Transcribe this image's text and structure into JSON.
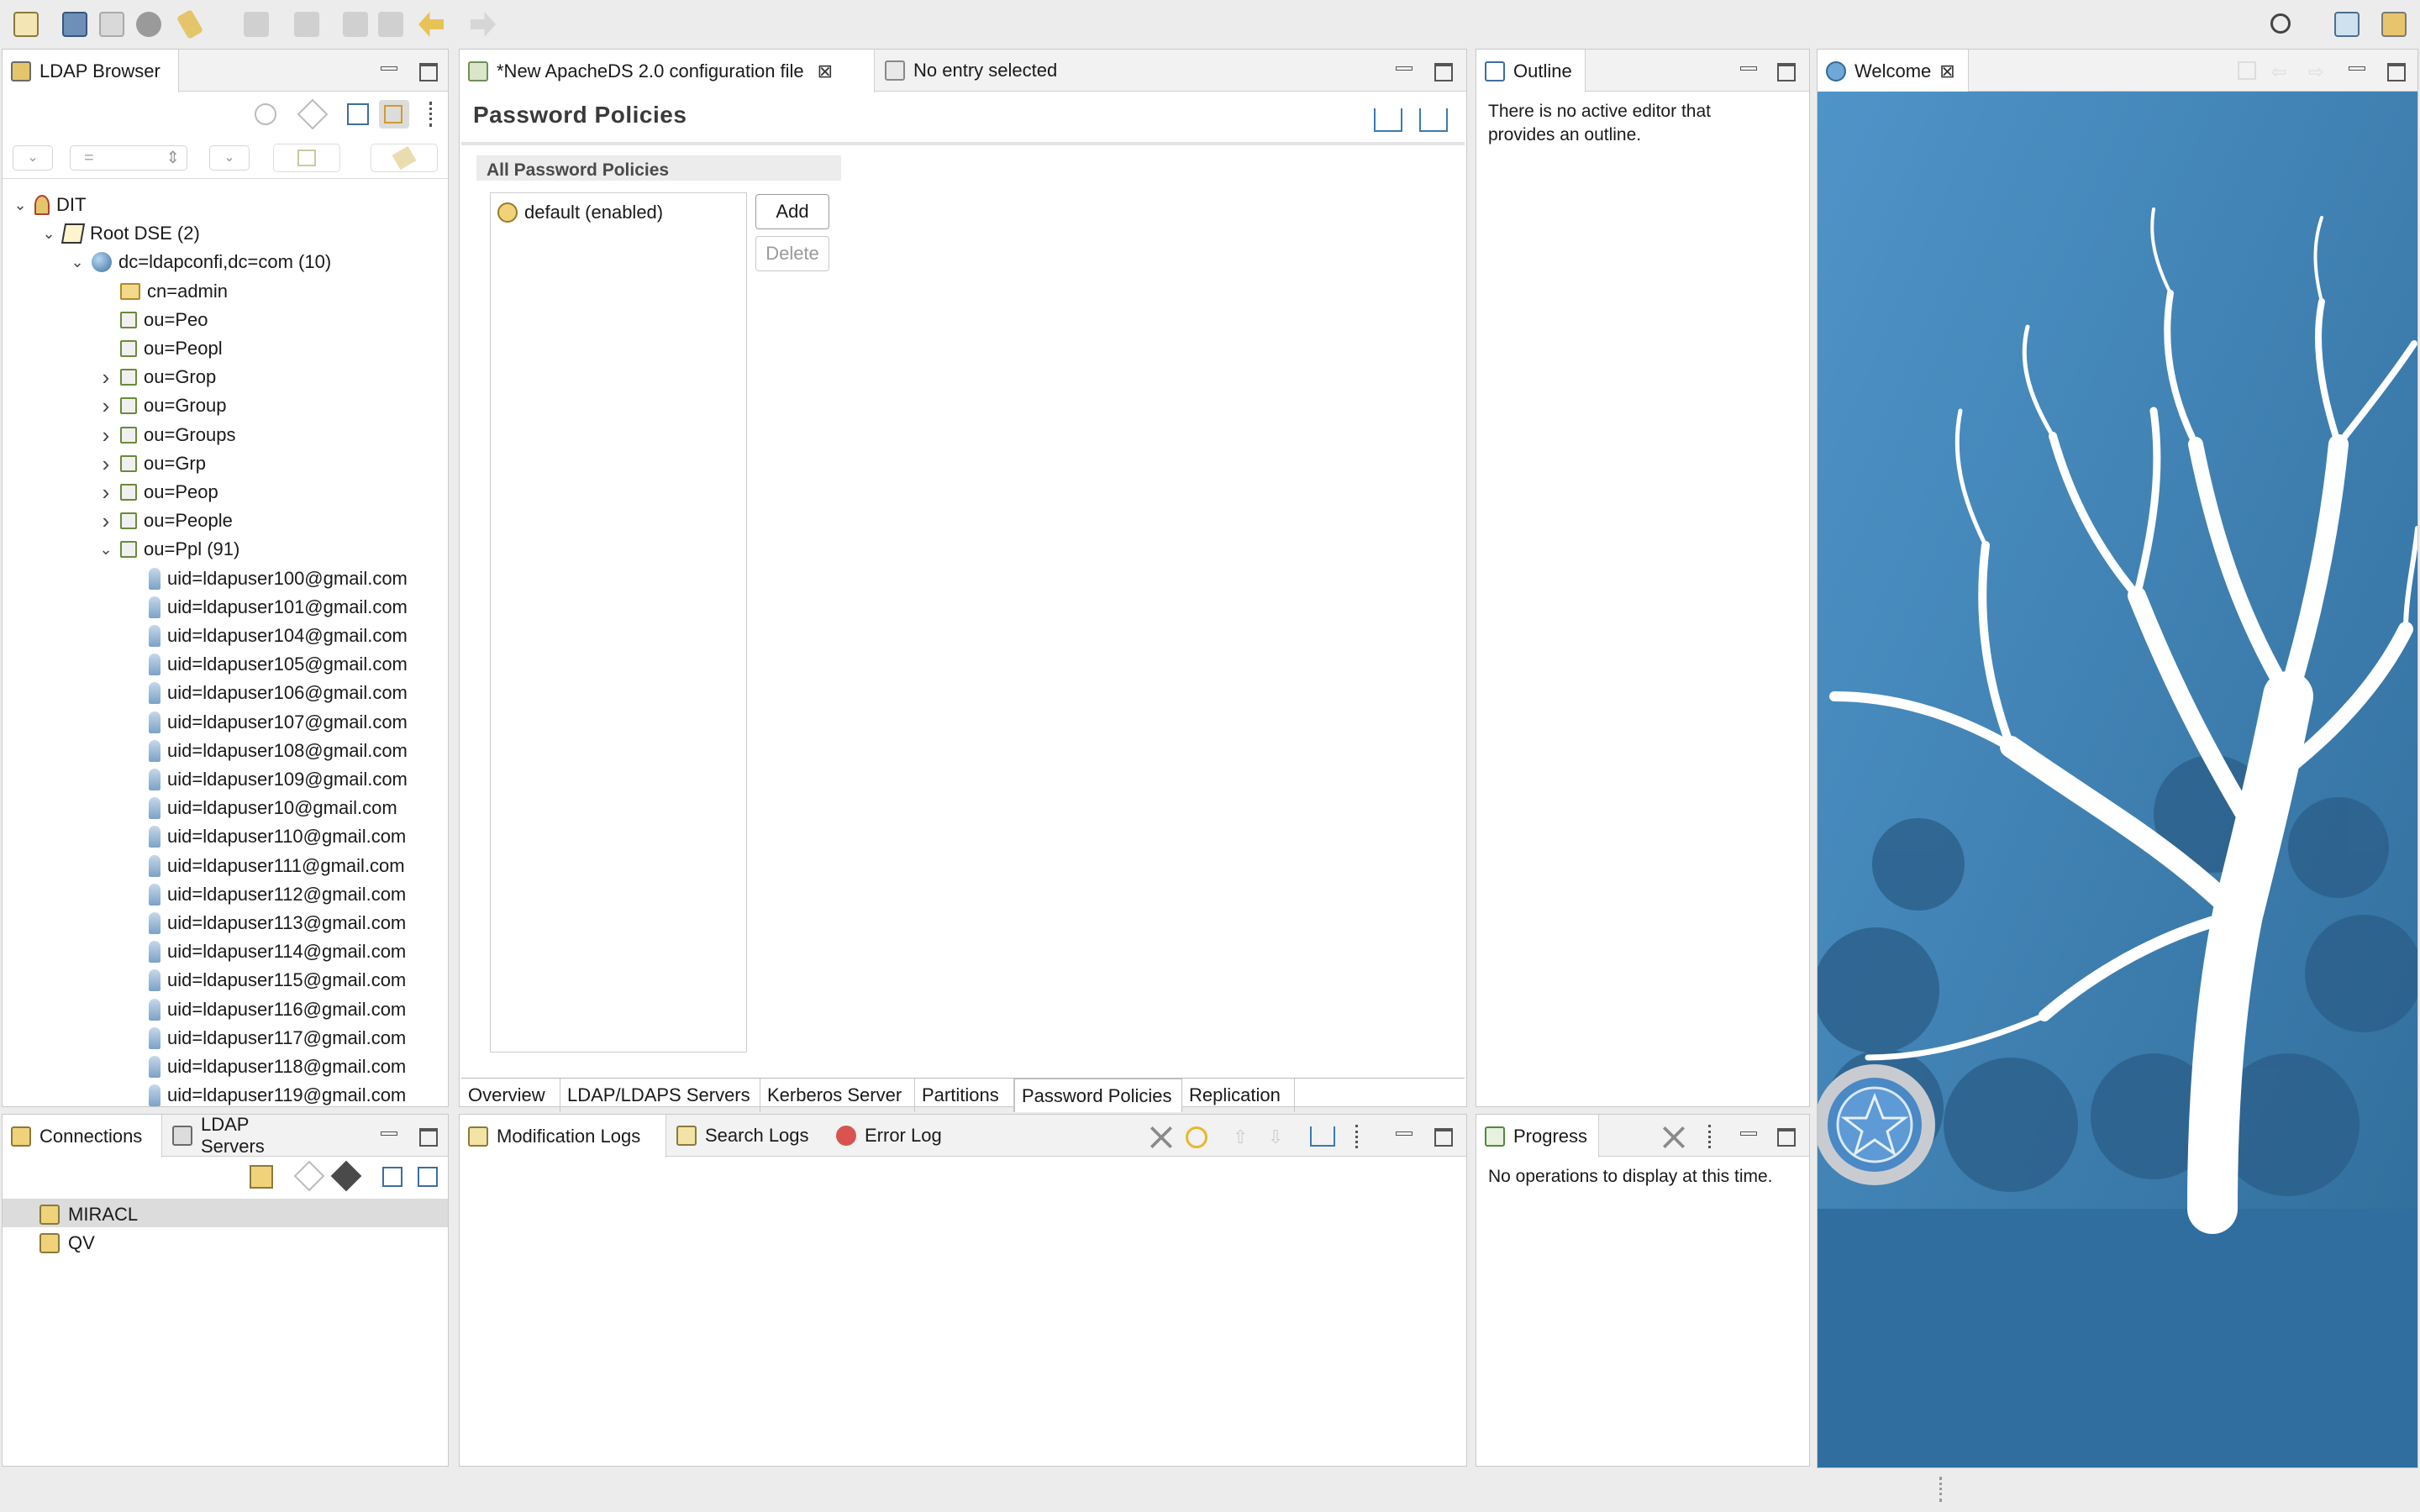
{
  "browser": {
    "tab_label": "LDAP Browser",
    "filter_value": "=",
    "tree": [
      {
        "label": "DIT",
        "level": 0,
        "expanded": true,
        "icon": "dit-icon"
      },
      {
        "label": "Root DSE (2)",
        "level": 1,
        "expanded": true,
        "icon": "rootdse-icon"
      },
      {
        "label": "dc=ldapconfi,dc=com (10)",
        "level": 2,
        "expanded": true,
        "icon": "globe-icon"
      },
      {
        "label": "cn=admin",
        "level": 3,
        "expanded": null,
        "icon": "folder-icon"
      },
      {
        "label": "ou=Peo",
        "level": 3,
        "expanded": null,
        "icon": "ou-icon"
      },
      {
        "label": "ou=Peopl",
        "level": 3,
        "expanded": null,
        "icon": "ou-icon"
      },
      {
        "label": "ou=Grop",
        "level": 3,
        "expanded": false,
        "icon": "ou-icon"
      },
      {
        "label": "ou=Group",
        "level": 3,
        "expanded": false,
        "icon": "ou-icon"
      },
      {
        "label": "ou=Groups",
        "level": 3,
        "expanded": false,
        "icon": "ou-icon"
      },
      {
        "label": "ou=Grp",
        "level": 3,
        "expanded": false,
        "icon": "ou-icon"
      },
      {
        "label": "ou=Peop",
        "level": 3,
        "expanded": false,
        "icon": "ou-icon"
      },
      {
        "label": "ou=People",
        "level": 3,
        "expanded": false,
        "icon": "ou-icon"
      },
      {
        "label": "ou=Ppl (91)",
        "level": 3,
        "expanded": true,
        "icon": "ou-icon"
      },
      {
        "label": "uid=ldapuser100@gmail.com",
        "level": 4,
        "expanded": null,
        "icon": "person-icon"
      },
      {
        "label": "uid=ldapuser101@gmail.com",
        "level": 4,
        "expanded": null,
        "icon": "person-icon"
      },
      {
        "label": "uid=ldapuser104@gmail.com",
        "level": 4,
        "expanded": null,
        "icon": "person-icon"
      },
      {
        "label": "uid=ldapuser105@gmail.com",
        "level": 4,
        "expanded": null,
        "icon": "person-icon"
      },
      {
        "label": "uid=ldapuser106@gmail.com",
        "level": 4,
        "expanded": null,
        "icon": "person-icon"
      },
      {
        "label": "uid=ldapuser107@gmail.com",
        "level": 4,
        "expanded": null,
        "icon": "person-icon"
      },
      {
        "label": "uid=ldapuser108@gmail.com",
        "level": 4,
        "expanded": null,
        "icon": "person-icon"
      },
      {
        "label": "uid=ldapuser109@gmail.com",
        "level": 4,
        "expanded": null,
        "icon": "person-icon"
      },
      {
        "label": "uid=ldapuser10@gmail.com",
        "level": 4,
        "expanded": null,
        "icon": "person-icon"
      },
      {
        "label": "uid=ldapuser110@gmail.com",
        "level": 4,
        "expanded": null,
        "icon": "person-icon"
      },
      {
        "label": "uid=ldapuser111@gmail.com",
        "level": 4,
        "expanded": null,
        "icon": "person-icon"
      },
      {
        "label": "uid=ldapuser112@gmail.com",
        "level": 4,
        "expanded": null,
        "icon": "person-icon"
      },
      {
        "label": "uid=ldapuser113@gmail.com",
        "level": 4,
        "expanded": null,
        "icon": "person-icon"
      },
      {
        "label": "uid=ldapuser114@gmail.com",
        "level": 4,
        "expanded": null,
        "icon": "person-icon"
      },
      {
        "label": "uid=ldapuser115@gmail.com",
        "level": 4,
        "expanded": null,
        "icon": "person-icon"
      },
      {
        "label": "uid=ldapuser116@gmail.com",
        "level": 4,
        "expanded": null,
        "icon": "person-icon"
      },
      {
        "label": "uid=ldapuser117@gmail.com",
        "level": 4,
        "expanded": null,
        "icon": "person-icon"
      },
      {
        "label": "uid=ldapuser118@gmail.com",
        "level": 4,
        "expanded": null,
        "icon": "person-icon"
      },
      {
        "label": "uid=ldapuser119@gmail.com",
        "level": 4,
        "expanded": null,
        "icon": "person-icon"
      }
    ]
  },
  "editor": {
    "tabs": [
      "*New ApacheDS 2.0 configuration file",
      "No entry selected"
    ],
    "page_title": "Password Policies",
    "section_title": "All Password Policies",
    "policies": [
      "default (enabled)"
    ],
    "add_label": "Add",
    "delete_label": "Delete",
    "bottom_tabs": [
      "Overview",
      "LDAP/LDAPS Servers",
      "Kerberos Server",
      "Partitions",
      "Password Policies",
      "Replication"
    ],
    "active_bottom_tab": "Password Policies"
  },
  "outline": {
    "tab_label": "Outline",
    "message": "There is no active editor that provides an outline."
  },
  "welcome": {
    "tab_label": "Welcome",
    "bg_color": "#3f7fae"
  },
  "connections": {
    "tabs": [
      "Connections",
      "LDAP Servers"
    ],
    "items": [
      "MIRACL",
      "QV"
    ],
    "selected": "MIRACL"
  },
  "logs": {
    "tabs": [
      "Modification Logs",
      "Search Logs",
      "Error Log"
    ]
  },
  "progress": {
    "tab_label": "Progress",
    "message": "No operations to display at this time."
  }
}
